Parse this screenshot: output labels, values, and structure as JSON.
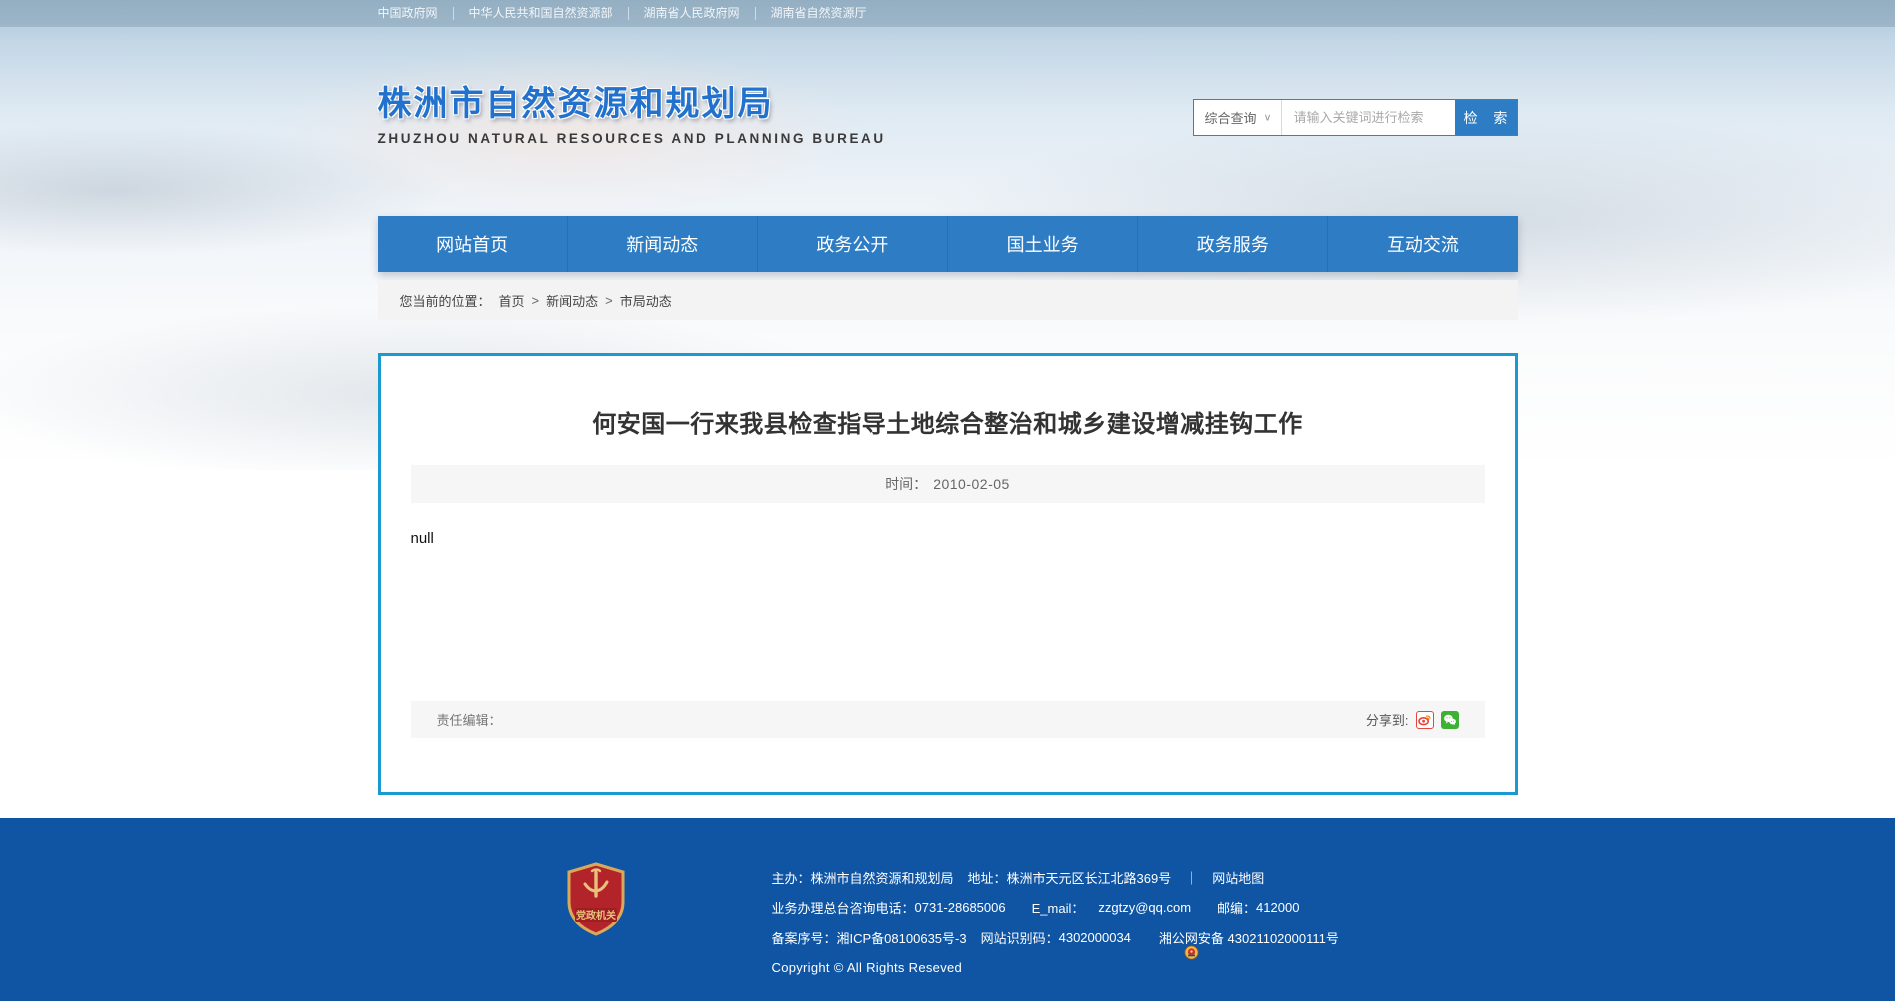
{
  "topbar": {
    "links": [
      "中国政府网",
      "中华人民共和国自然资源部",
      "湖南省人民政府网",
      "湖南省自然资源厅"
    ]
  },
  "header": {
    "site_title": "株洲市自然资源和规划局",
    "site_subtitle": "ZHUZHOU NATURAL RESOURCES AND PLANNING BUREAU",
    "search": {
      "category": "综合查询",
      "chevron": "∨",
      "placeholder": "请输入关键词进行检索",
      "button": "检 索"
    }
  },
  "nav": {
    "items": [
      "网站首页",
      "新闻动态",
      "政务公开",
      "国土业务",
      "政务服务",
      "互动交流"
    ]
  },
  "breadcrumb": {
    "label": "您当前的位置：",
    "separator": ">",
    "items": [
      "首页",
      "新闻动态",
      "市局动态"
    ]
  },
  "article": {
    "title": "何安国一行来我县检查指导土地综合整治和城乡建设增减挂钩工作",
    "date_label": "时间：",
    "date": "2010-02-05",
    "body": "null",
    "editor_label": "责任编辑：",
    "share_label": "分享到:"
  },
  "footer": {
    "badge_text": "党政机关",
    "line1": {
      "host_label": "主办：",
      "host": "株洲市自然资源和规划局",
      "addr_label": "地址：",
      "addr": "株洲市天元区长江北路369号",
      "divider": "｜",
      "sitemap": "网站地图"
    },
    "line2": {
      "phone_label": "业务办理总台咨询电话：",
      "phone": "0731-28685006",
      "email_label": "E_mail：",
      "email": "zzgtzy@qq.com",
      "zip_label": "邮编：",
      "zip": "412000"
    },
    "line3": {
      "icp_label": "备案序号：",
      "icp": "湘ICP备08100635号-3",
      "site_id_label": "网站识别码：",
      "site_id": "4302000034",
      "police": "湘公网安备 43021102000111号"
    },
    "copyright": "Copyright © All Rights Reseved"
  },
  "colors": {
    "accent_blue": "#2e7dc4",
    "title_blue": "#2171cd",
    "article_border": "#1b9ad2",
    "footer_blue": "#0f55a4",
    "weibo_red": "#e6453c",
    "wechat_green": "#3eb134",
    "badge_red": "#b3232a",
    "badge_gold": "#d9a959"
  }
}
